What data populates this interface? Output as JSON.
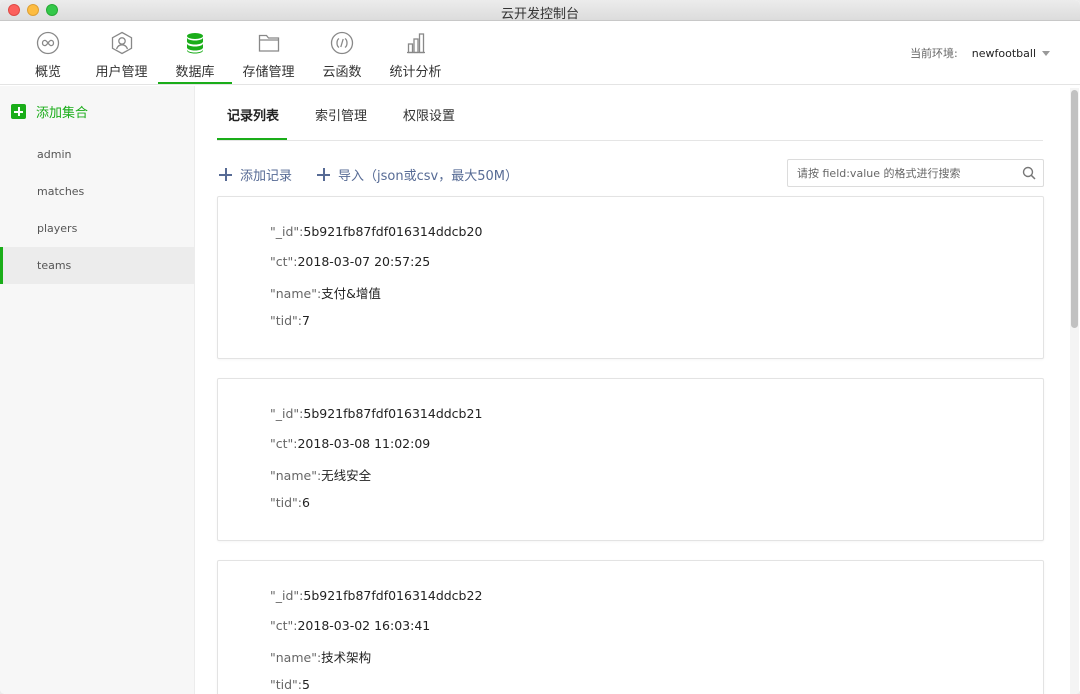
{
  "window": {
    "title": "云开发控制台"
  },
  "toolbar": {
    "items": [
      {
        "label": "概览",
        "icon": "infinity-icon"
      },
      {
        "label": "用户管理",
        "icon": "user-icon"
      },
      {
        "label": "数据库",
        "icon": "database-icon",
        "active": true
      },
      {
        "label": "存储管理",
        "icon": "folder-icon"
      },
      {
        "label": "云函数",
        "icon": "function-icon"
      },
      {
        "label": "统计分析",
        "icon": "bar-chart-icon"
      }
    ],
    "env_label": "当前环境:",
    "env_value": "newfootball"
  },
  "sidebar": {
    "add_label": "添加集合",
    "collections": [
      "admin",
      "matches",
      "players",
      "teams"
    ],
    "active": "teams"
  },
  "main": {
    "tabs": [
      "记录列表",
      "索引管理",
      "权限设置"
    ],
    "active_tab": "记录列表",
    "add_record_label": "添加记录",
    "import_label": "导入（json或csv，最大50M）",
    "search_placeholder": "请按 field:value 的格式进行搜索"
  },
  "records": [
    {
      "id_key": "\"_id\":",
      "id": "5b921fb87fdf016314ddcb20",
      "ct_key": "\"ct\":",
      "ct": "2018-03-07 20:57:25",
      "name_key": "\"name\":",
      "name": "支付&增值",
      "tid_key": "\"tid\":",
      "tid": "7"
    },
    {
      "id_key": "\"_id\":",
      "id": "5b921fb87fdf016314ddcb21",
      "ct_key": "\"ct\":",
      "ct": "2018-03-08 11:02:09",
      "name_key": "\"name\":",
      "name": "无线安全",
      "tid_key": "\"tid\":",
      "tid": "6"
    },
    {
      "id_key": "\"_id\":",
      "id": "5b921fb87fdf016314ddcb22",
      "ct_key": "\"ct\":",
      "ct": "2018-03-02 16:03:41",
      "name_key": "\"name\":",
      "name": "技术架构",
      "tid_key": "\"tid\":",
      "tid": "5"
    }
  ],
  "colors": {
    "accent": "#1aad19",
    "link": "#576b95"
  }
}
